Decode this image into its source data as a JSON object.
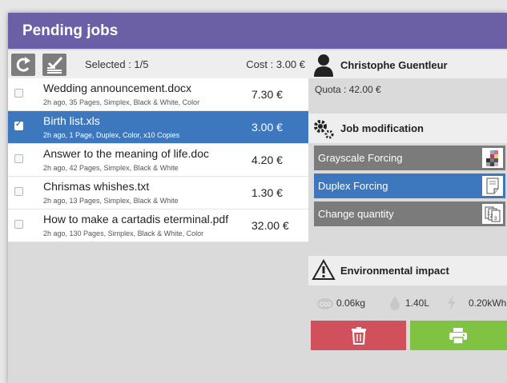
{
  "header": {
    "title": "Pending jobs"
  },
  "toolbar": {
    "selected": "Selected : 1/5",
    "cost": "Cost : 3.00 €"
  },
  "jobs": [
    {
      "name": "Wedding announcement.docx",
      "details": "2h ago, 35 Pages, Simplex, Black & White, Color",
      "price": "7.30 €",
      "checked": false
    },
    {
      "name": "Birth list.xls",
      "details": "2h ago, 1 Page, Duplex, Color, x10 Copies",
      "price": "3.00 €",
      "checked": true
    },
    {
      "name": "Answer to the meaning of life.doc",
      "details": "2h ago, 42 Pages, Simplex, Black & White",
      "price": "4.20 €",
      "checked": false
    },
    {
      "name": "Chrismas whishes.txt",
      "details": "2h ago, 13 Pages, Simplex, Black & White",
      "price": "1.30 €",
      "checked": false
    },
    {
      "name": "How to make a cartadis eterminal.pdf",
      "details": "2h ago, 130 Pages, Simplex, Black & White, Color",
      "price": "32.00 €",
      "checked": false
    }
  ],
  "user": {
    "name": "Christophe Guentleur",
    "quota": "Quota : 42.00 €"
  },
  "modification": {
    "title": "Job modification",
    "options": [
      {
        "label": "Grayscale Forcing",
        "active": false,
        "icon": "color-swatch-icon"
      },
      {
        "label": "Duplex Forcing",
        "active": true,
        "icon": "duplex-page-icon"
      },
      {
        "label": "Change quantity",
        "active": false,
        "icon": "copies-icon"
      }
    ]
  },
  "environment": {
    "title": "Environmental impact",
    "co2": "0.06kg",
    "water": "1.40L",
    "energy": "0.20kWh",
    "co2_icon_text": "CO2"
  },
  "colors": {
    "header": "#6b5fa6",
    "selected": "#3d78be",
    "delete": "#d0505b",
    "print": "#80c342",
    "option": "#7b7b7b"
  }
}
